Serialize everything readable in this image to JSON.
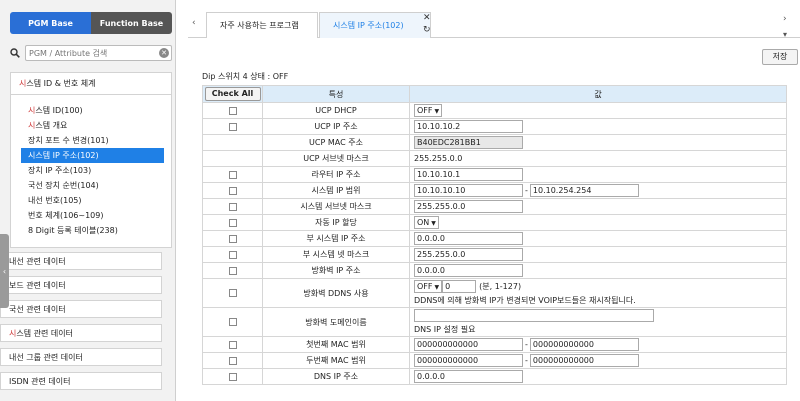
{
  "sidebar": {
    "tabs": {
      "pgm": "PGM Base",
      "func": "Function Base"
    },
    "search_placeholder": "PGM / Attribute 검색",
    "group_title_first": "시",
    "group_title_rest": "스템 ID & 번호 체계",
    "items": [
      {
        "first": "시",
        "rest": "스템 ID(100)"
      },
      {
        "first": "시",
        "rest": "스템 개요"
      },
      {
        "first": "",
        "rest": "장치 포트 수 변경(101)"
      },
      {
        "first": "시",
        "rest": "스템 IP 주소(102)"
      },
      {
        "first": "",
        "rest": "장치 IP 주소(103)"
      },
      {
        "first": "",
        "rest": "국선 장치 순번(104)"
      },
      {
        "first": "",
        "rest": "내선 번호(105)"
      },
      {
        "first": "",
        "rest": "번호 체계(106~109)"
      },
      {
        "first": "",
        "rest": "8 Digit 등록 테이블(238)"
      }
    ],
    "sections": [
      {
        "first": "",
        "rest": "내선 관련 데이터"
      },
      {
        "first": "",
        "rest": "보드 관련 데이터"
      },
      {
        "first": "",
        "rest": "국선 관련 데이터"
      },
      {
        "first": "시",
        "rest": "스템 관련 데이터"
      },
      {
        "first": "",
        "rest": "내선 그룹 관련 데이터"
      },
      {
        "first": "",
        "rest": "ISDN 관련 데이터"
      }
    ]
  },
  "tabbar": {
    "prev": "‹",
    "next": "›",
    "menu": "▾",
    "tab1": "자주 사용하는 프로그램",
    "tab2": "시스템 IP 주소(102)",
    "close": "✕",
    "refresh": "↻"
  },
  "toolbar": {
    "save": "저장"
  },
  "dip_status": "Dip 스위치 4 상태 : OFF",
  "grid": {
    "check_all": "Check All",
    "col_attr": "특성",
    "col_value": "값",
    "rows": {
      "ucp_dhcp": {
        "label": "UCP DHCP",
        "value": "OFF"
      },
      "ucp_ip": {
        "label": "UCP IP 주소",
        "value": "10.10.10.2"
      },
      "ucp_mac": {
        "label": "UCP MAC 주소",
        "value": "B40EDC281BB1"
      },
      "ucp_subnet": {
        "label": "UCP 서브넷 마스크",
        "value": "255.255.0.0"
      },
      "router_ip": {
        "label": "라우터 IP 주소",
        "value": "10.10.10.1"
      },
      "sys_ip_range": {
        "label": "시스템 IP 범위",
        "from": "10.10.10.10",
        "to": "10.10.254.254"
      },
      "sys_subnet": {
        "label": "시스템 서브넷 마스크",
        "value": "255.255.0.0"
      },
      "auto_ip": {
        "label": "자동 IP 할당",
        "value": "ON"
      },
      "sub_sys_ip": {
        "label": "부 시스템 IP 주소",
        "value": "0.0.0.0"
      },
      "sub_sys_netmask": {
        "label": "부 시스템 넷 마스크",
        "value": "255.255.0.0"
      },
      "fw_ip": {
        "label": "방화벽 IP 주소",
        "value": "0.0.0.0"
      },
      "fw_ddns": {
        "label": "방화벽 DDNS 사용",
        "value": "OFF",
        "minutes": "0",
        "unit": "(분, 1-127)",
        "note": "DDNS에 의해 방화벽 IP가 변경되면 VOIP보드들은 재시작됩니다."
      },
      "fw_domain": {
        "label": "방화벽 도메인이름",
        "value": "",
        "note": "DNS IP 설정 필요"
      },
      "mac_range1": {
        "label": "첫번째 MAC 범위",
        "from": "000000000000",
        "to": "000000000000"
      },
      "mac_range2": {
        "label": "두번째 MAC 범위",
        "from": "000000000000",
        "to": "000000000000"
      },
      "dns_ip": {
        "label": "DNS IP 주소",
        "value": "0.0.0.0"
      }
    }
  }
}
